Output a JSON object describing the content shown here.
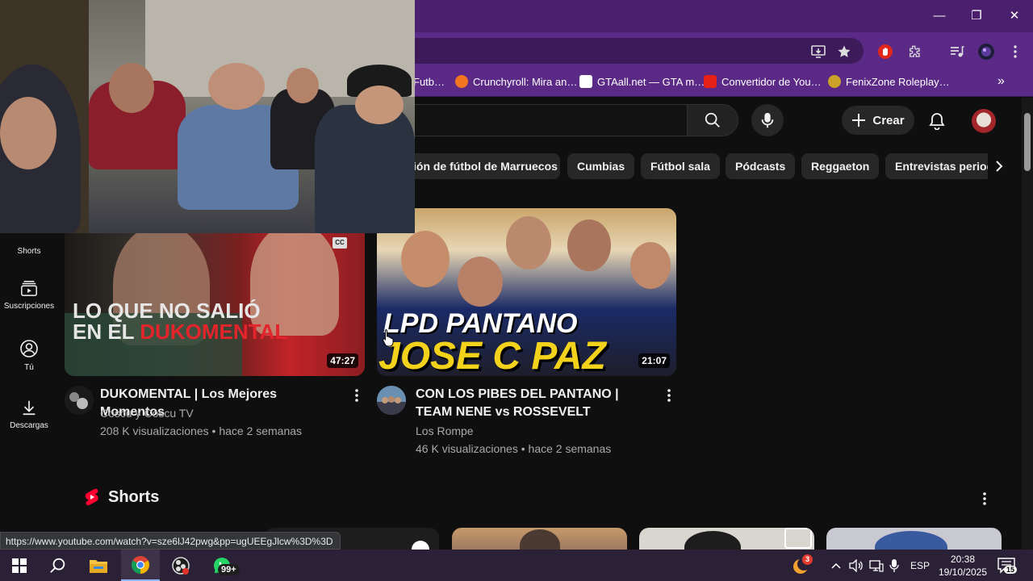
{
  "browser": {
    "window_controls": {
      "minimize": "—",
      "maximize": "❐",
      "close": "✕"
    },
    "bookmarks": [
      {
        "label": "Futb…",
        "color": "#5b2a87"
      },
      {
        "label": "Crunchyroll: Mira an…",
        "color": "#f47521"
      },
      {
        "label": "GTAall.net — GTA m…",
        "color": "#ffffff"
      },
      {
        "label": "Convertidor de You…",
        "color": "#e62117"
      },
      {
        "label": "FenixZone Roleplay…",
        "color": "#c9a227"
      }
    ],
    "bookmarks_more": "»"
  },
  "youtube": {
    "create_label": "Crear",
    "chips": [
      "ión de fútbol de Marruecos",
      "Cumbias",
      "Fútbol sala",
      "Pódcasts",
      "Reggaeton",
      "Entrevistas period"
    ],
    "nav": [
      {
        "label": "Shorts"
      },
      {
        "label": "Suscripciones"
      },
      {
        "label": "Tú"
      },
      {
        "label": "Descargas"
      }
    ],
    "videos": [
      {
        "title": "DUKOMENTAL | Los Mejores Momentos",
        "channel": "Coscu y Coscu TV",
        "meta": "208 K visualizaciones • hace 2 semanas",
        "duration": "47:27",
        "thumb_text_line1": "LO QUE NO SALIÓ",
        "thumb_text_line2a": "EN EL ",
        "thumb_text_line2b": "DUKOMENTAL",
        "cc": "CC"
      },
      {
        "title": "CON LOS PIBES DEL PANTANO | TEAM NENE vs ROSSEVELT",
        "channel": "Los Rompe",
        "meta": "46 K visualizaciones • hace 2 semanas",
        "duration": "21:07",
        "thumb_text_line1": "LPD PANTANO",
        "thumb_text_line2": "JOSE C PAZ"
      }
    ],
    "shorts_title": "Shorts",
    "status_url": "https://www.youtube.com/watch?v=sze6lJ42pwg&pp=ugUEEgJlcw%3D%3D"
  },
  "taskbar": {
    "whatsapp_badge": "99+",
    "weather_badge": "3",
    "lang": "ESP",
    "time": "20:38",
    "date": "19/10/2025",
    "notifications": "15"
  }
}
